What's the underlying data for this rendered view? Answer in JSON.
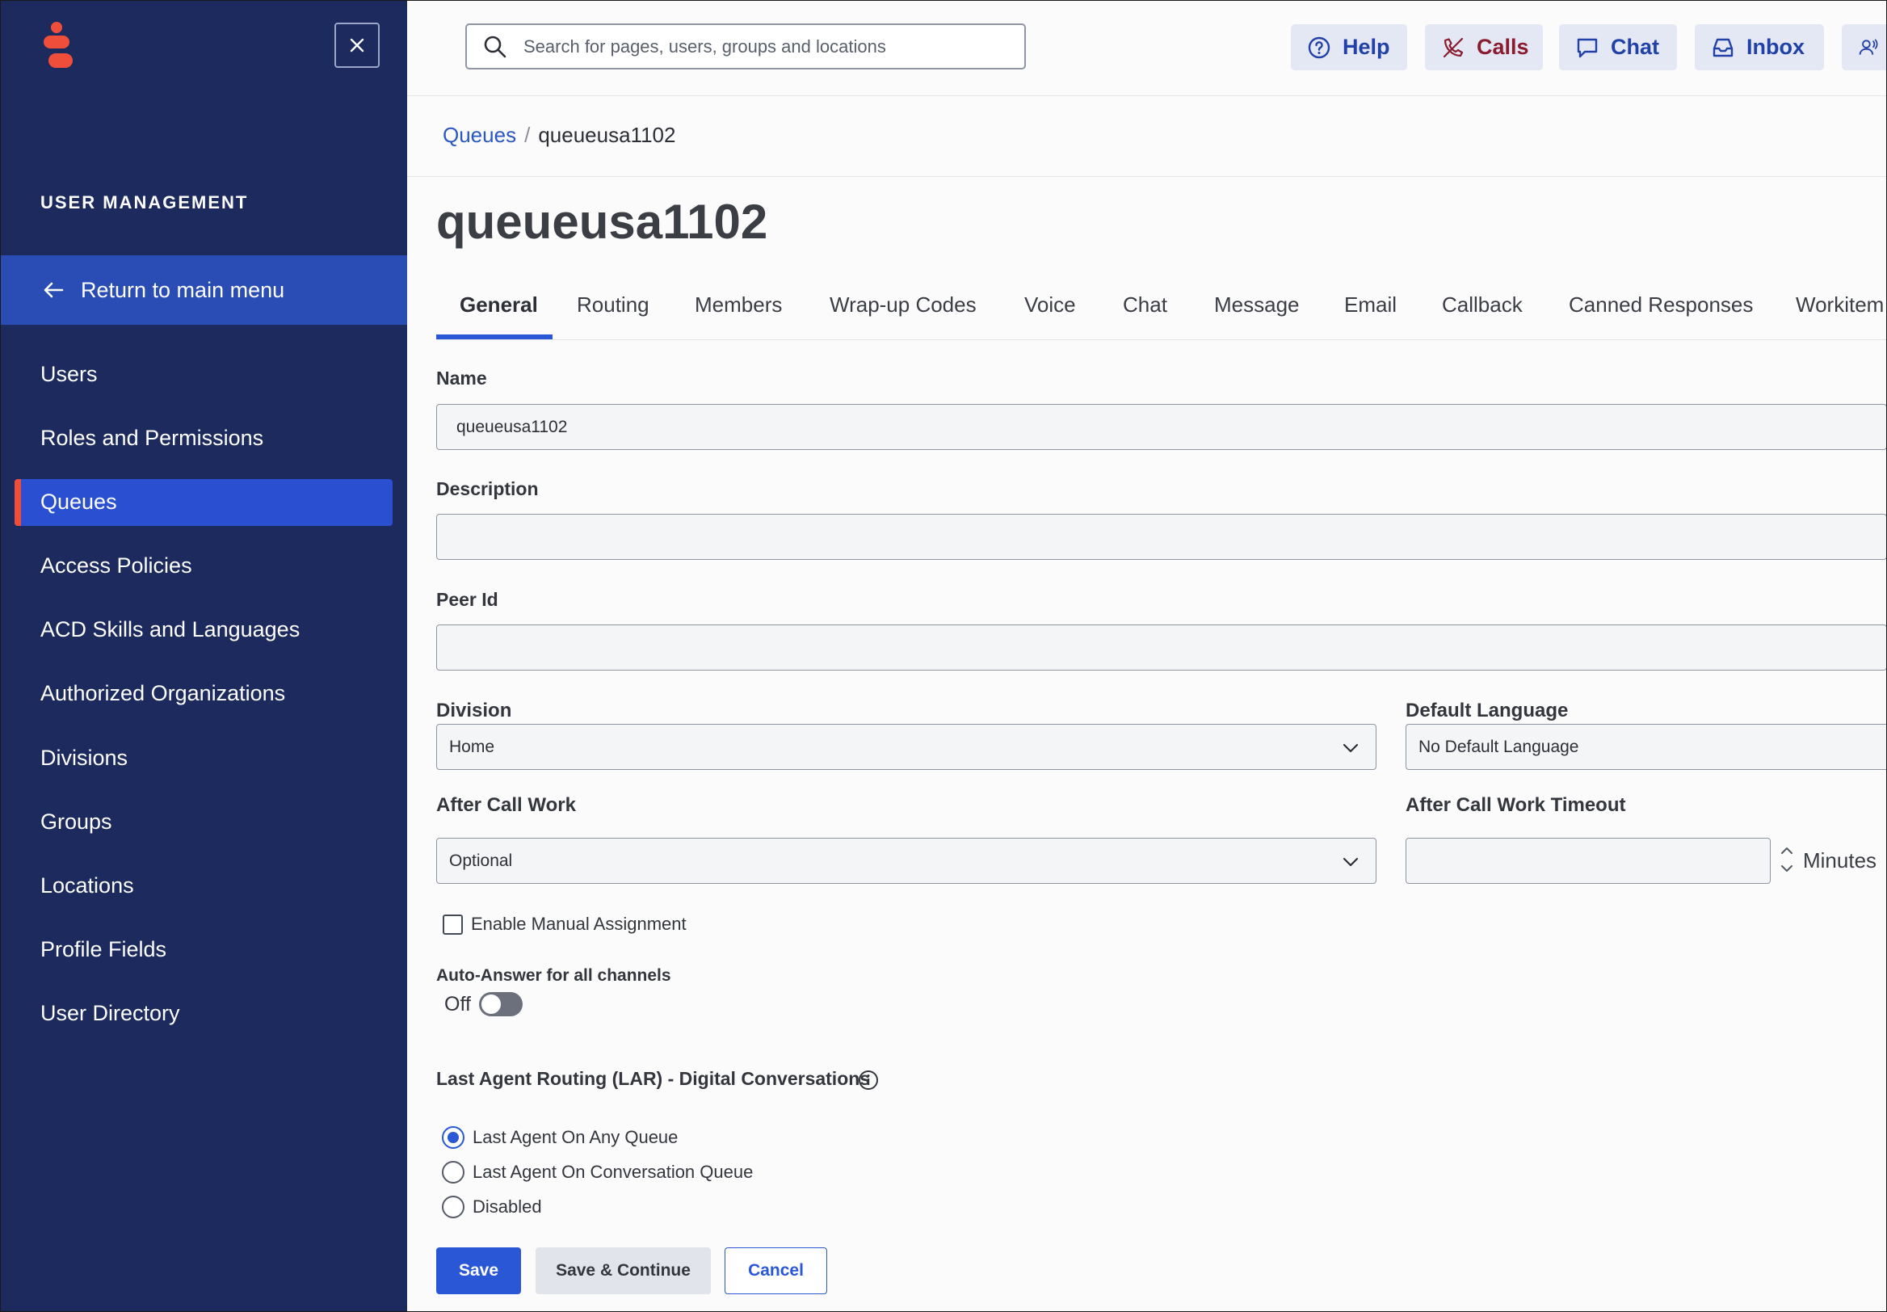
{
  "sidebar": {
    "section_title": "USER MANAGEMENT",
    "return_label": "Return to main menu",
    "items": [
      {
        "label": "Users"
      },
      {
        "label": "Roles and Permissions"
      },
      {
        "label": "Queues",
        "active": true
      },
      {
        "label": "Access Policies"
      },
      {
        "label": "ACD Skills and Languages"
      },
      {
        "label": "Authorized Organizations"
      },
      {
        "label": "Divisions"
      },
      {
        "label": "Groups"
      },
      {
        "label": "Locations"
      },
      {
        "label": "Profile Fields"
      },
      {
        "label": "User Directory"
      }
    ]
  },
  "topbar": {
    "search_placeholder": "Search for pages, users, groups and locations",
    "buttons": {
      "help": "Help",
      "calls": "Calls",
      "chat": "Chat",
      "inbox": "Inbox"
    }
  },
  "breadcrumb": {
    "parent": "Queues",
    "separator": "/",
    "current": "queueusa1102"
  },
  "page_title": "queueusa1102",
  "tabs": [
    "General",
    "Routing",
    "Members",
    "Wrap-up Codes",
    "Voice",
    "Chat",
    "Message",
    "Email",
    "Callback",
    "Canned Responses",
    "Workitem"
  ],
  "active_tab": "General",
  "form": {
    "name_label": "Name",
    "name_value": "queueusa1102",
    "description_label": "Description",
    "description_value": "",
    "peer_label": "Peer Id",
    "peer_value": "",
    "division_label": "Division",
    "division_value": "Home",
    "language_label": "Default Language",
    "language_value": "No Default Language",
    "acw_label": "After Call Work",
    "acw_value": "Optional",
    "acw_timeout_label": "After Call Work Timeout",
    "acw_timeout_value": "",
    "acw_timeout_unit": "Minutes",
    "manual_assignment_label": "Enable Manual Assignment",
    "manual_assignment_checked": false,
    "auto_answer_label": "Auto-Answer for all channels",
    "auto_answer_state": "Off",
    "lar_label": "Last Agent Routing (LAR) - Digital Conversations",
    "lar_options": [
      "Last Agent On Any Queue",
      "Last Agent On Conversation Queue",
      "Disabled"
    ],
    "lar_selected": "Last Agent On Any Queue"
  },
  "actions": {
    "save": "Save",
    "save_continue": "Save & Continue",
    "cancel": "Cancel"
  },
  "colors": {
    "sidebar_bg": "#1c2a5e",
    "accent": "#2a57d6",
    "logo": "#ef4e3a",
    "calls": "#8a1c2f"
  }
}
